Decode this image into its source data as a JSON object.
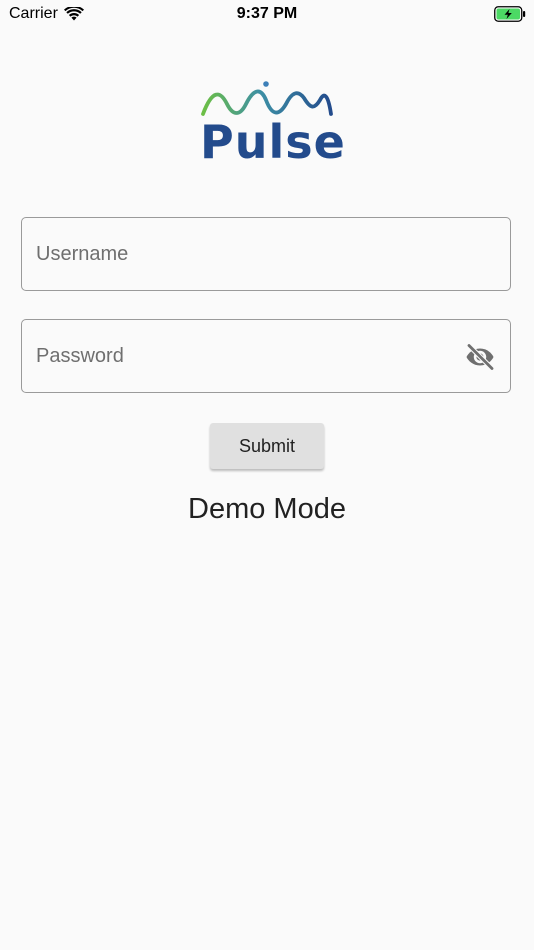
{
  "status_bar": {
    "carrier": "Carrier",
    "time": "9:37 PM",
    "wifi_icon": "wifi-icon",
    "battery_icon": "battery-charging-icon"
  },
  "logo": {
    "text": "Pulse",
    "wave_colors": [
      "#6cbf45",
      "#234b8c"
    ]
  },
  "login_form": {
    "username_placeholder": "Username",
    "username_value": "",
    "password_placeholder": "Password",
    "password_value": "",
    "visibility_icon": "eye-off-icon",
    "submit_label": "Submit"
  },
  "demo_mode_label": "Demo Mode",
  "colors": {
    "background": "#fafafa",
    "brand_blue": "#234b8c",
    "brand_green": "#6cbf45",
    "button_bg": "#e0e0e0",
    "battery_green": "#4cd964"
  }
}
